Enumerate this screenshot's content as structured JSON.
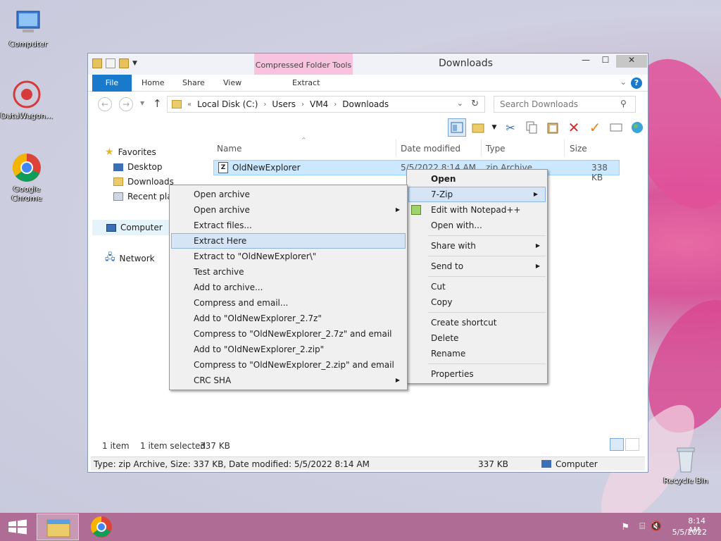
{
  "desktop": {
    "icons": [
      {
        "label": "Computer"
      },
      {
        "label": "DataWagon..."
      },
      {
        "label": "Google Chrome"
      },
      {
        "label": "Recycle Bin"
      }
    ]
  },
  "window": {
    "title": "Downloads",
    "contextual_group": "Compressed Folder Tools",
    "tabs": [
      "File",
      "Home",
      "Share",
      "View",
      "Extract"
    ],
    "help": "?",
    "minimize": "—",
    "maximize": "☐",
    "close": "✕",
    "address": {
      "prefix": "«",
      "parts": [
        "Local Disk (C:)",
        "Users",
        "VM4",
        "Downloads"
      ]
    },
    "search": {
      "placeholder": "Search Downloads"
    },
    "nav": {
      "favorites": "Favorites",
      "desktop": "Desktop",
      "downloads": "Downloads",
      "recent": "Recent plac",
      "computer": "Computer",
      "network": "Network"
    },
    "columns": {
      "name": "Name",
      "date": "Date modified",
      "type": "Type",
      "size": "Size"
    },
    "files": [
      {
        "name": "OldNewExplorer",
        "date": "5/5/2022 8:14 AM",
        "type": "zip Archive",
        "size": "338 KB"
      }
    ],
    "status": {
      "count": "1 item",
      "selected": "1 item selected",
      "selected_size": "337 KB",
      "details": "Type: zip Archive, Size: 337 KB, Date modified: 5/5/2022 8:14 AM",
      "size": "337 KB",
      "location": "Computer"
    }
  },
  "context_menu": {
    "items": [
      "Open",
      "7-Zip",
      "Edit with Notepad++",
      "Open with...",
      "Share with",
      "Send to",
      "Cut",
      "Copy",
      "Create shortcut",
      "Delete",
      "Rename",
      "Properties"
    ]
  },
  "zip_menu": {
    "items": [
      "Open archive",
      "Open archive",
      "Extract files...",
      "Extract Here",
      "Extract to \"OldNewExplorer\\\"",
      "Test archive",
      "Add to archive...",
      "Compress and email...",
      "Add to \"OldNewExplorer_2.7z\"",
      "Compress to \"OldNewExplorer_2.7z\" and email",
      "Add to \"OldNewExplorer_2.zip\"",
      "Compress to \"OldNewExplorer_2.zip\" and email",
      "CRC SHA"
    ]
  },
  "taskbar": {
    "time": "8:14 AM",
    "date": "5/5/2022"
  },
  "colors": {
    "accent": "#1979ca",
    "taskbar": "#af6d95",
    "selection": "#cce8ff"
  }
}
